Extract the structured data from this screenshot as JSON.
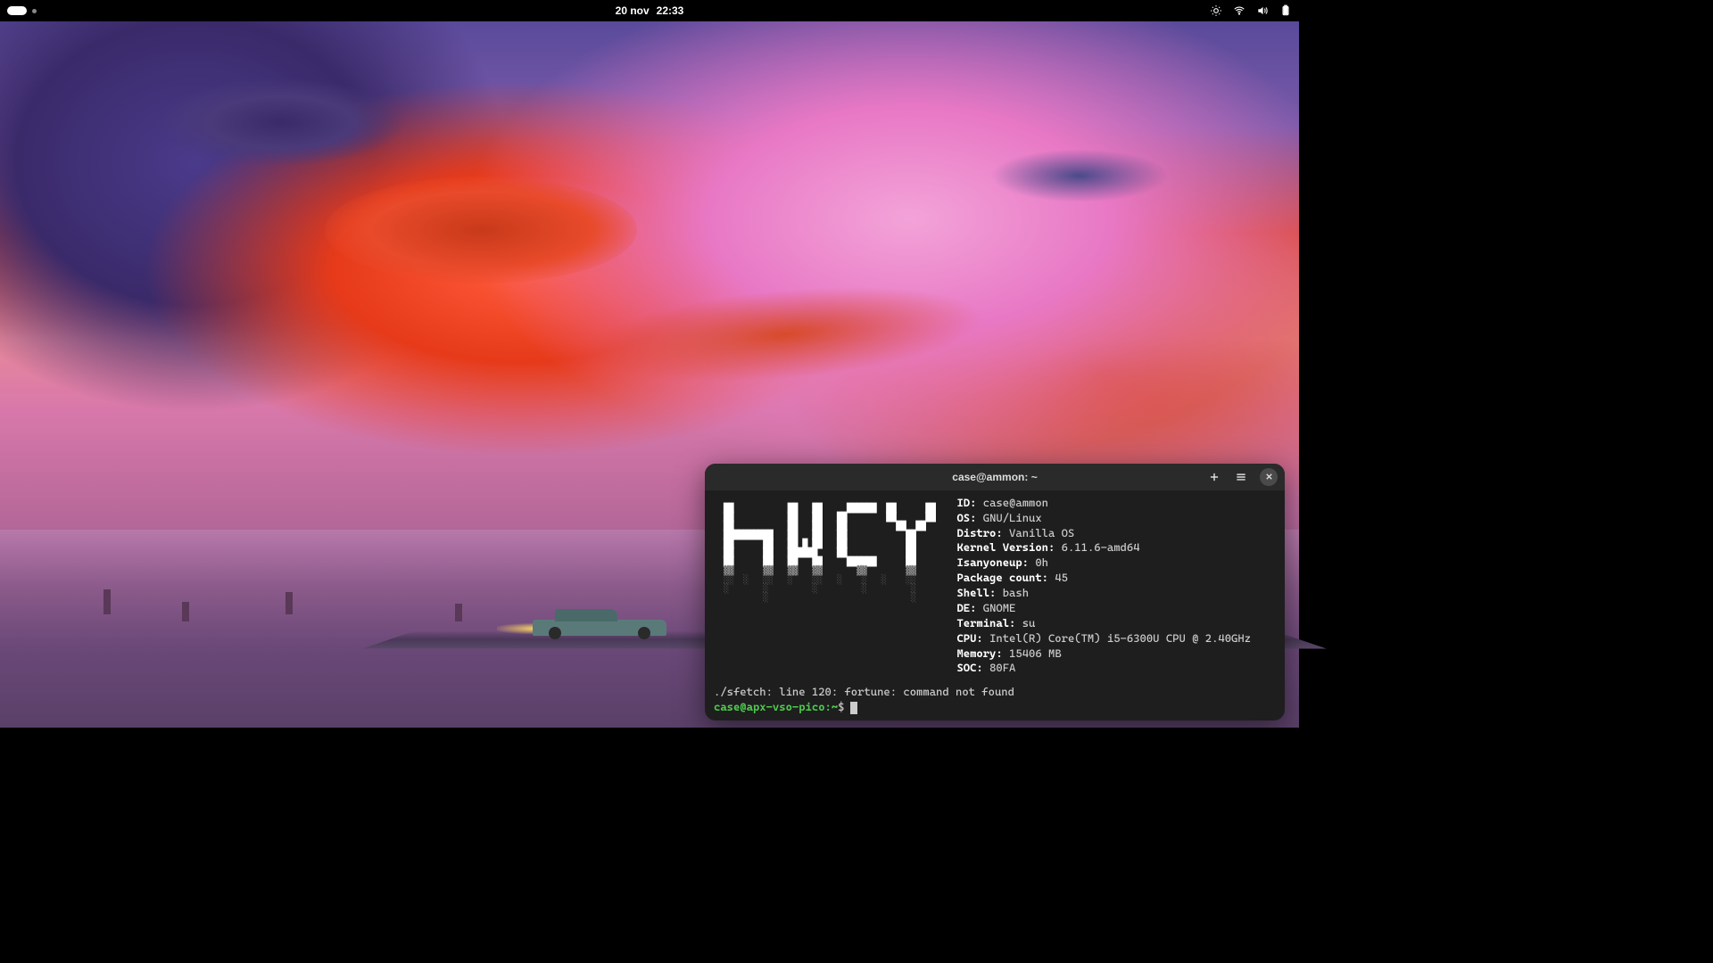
{
  "topbar": {
    "date": "20 nov",
    "time": "22:33"
  },
  "terminal": {
    "title": "case@ammon: ~",
    "info": [
      {
        "key": "ID:",
        "val": "case@ammon"
      },
      {
        "key": "OS:",
        "val": "GNU/Linux"
      },
      {
        "key": "Distro:",
        "val": "Vanilla OS"
      },
      {
        "key": "Kernel Version:",
        "val": "6.11.6-amd64"
      },
      {
        "key": "Isanyoneup:",
        "val": "0h"
      },
      {
        "key": "Package count:",
        "val": "45"
      },
      {
        "key": "Shell:",
        "val": "bash"
      },
      {
        "key": "DE:",
        "val": "GNOME"
      },
      {
        "key": "Terminal:",
        "val": "su"
      },
      {
        "key": "CPU:",
        "val": "Intel(R) Core(TM) i5-6300U CPU @ 2.40GHz"
      },
      {
        "key": "Memory:",
        "val": "15406 MB"
      },
      {
        "key": "SOC:",
        "val": "80FA"
      }
    ],
    "error": "./sfetch: line 120: fortune: command not found",
    "prompt_user": "case@apx-vso-pico",
    "prompt_path": "~",
    "prompt_symbol": "$"
  }
}
